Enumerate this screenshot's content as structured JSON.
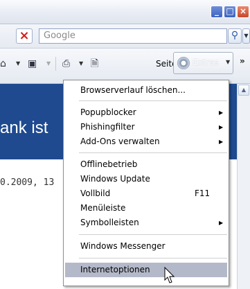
{
  "search": {
    "placeholder": "Google"
  },
  "toolbar": {
    "seite_label": "Seite",
    "extras_label": "Extras"
  },
  "page": {
    "banner_text": "ank ist",
    "date_text": "0.2009, 13"
  },
  "menu": {
    "items": [
      {
        "label": "Browserverlauf löschen...",
        "submenu": false
      },
      {
        "label": "Popupblocker",
        "submenu": true
      },
      {
        "label": "Phishingfilter",
        "submenu": true
      },
      {
        "label": "Add-Ons verwalten",
        "submenu": true
      },
      {
        "label": "Offlinebetrieb",
        "submenu": false
      },
      {
        "label": "Windows Update",
        "submenu": false
      },
      {
        "label": "Vollbild",
        "shortcut": "F11",
        "submenu": false
      },
      {
        "label": "Menüleiste",
        "submenu": false
      },
      {
        "label": "Symbolleisten",
        "submenu": true
      },
      {
        "label": "Windows Messenger",
        "submenu": false
      },
      {
        "label": "Internetoptionen",
        "submenu": false,
        "highlighted": true
      }
    ]
  },
  "colors": {
    "banner": "#1f4a8f",
    "highlight": "#b4b9c9"
  }
}
